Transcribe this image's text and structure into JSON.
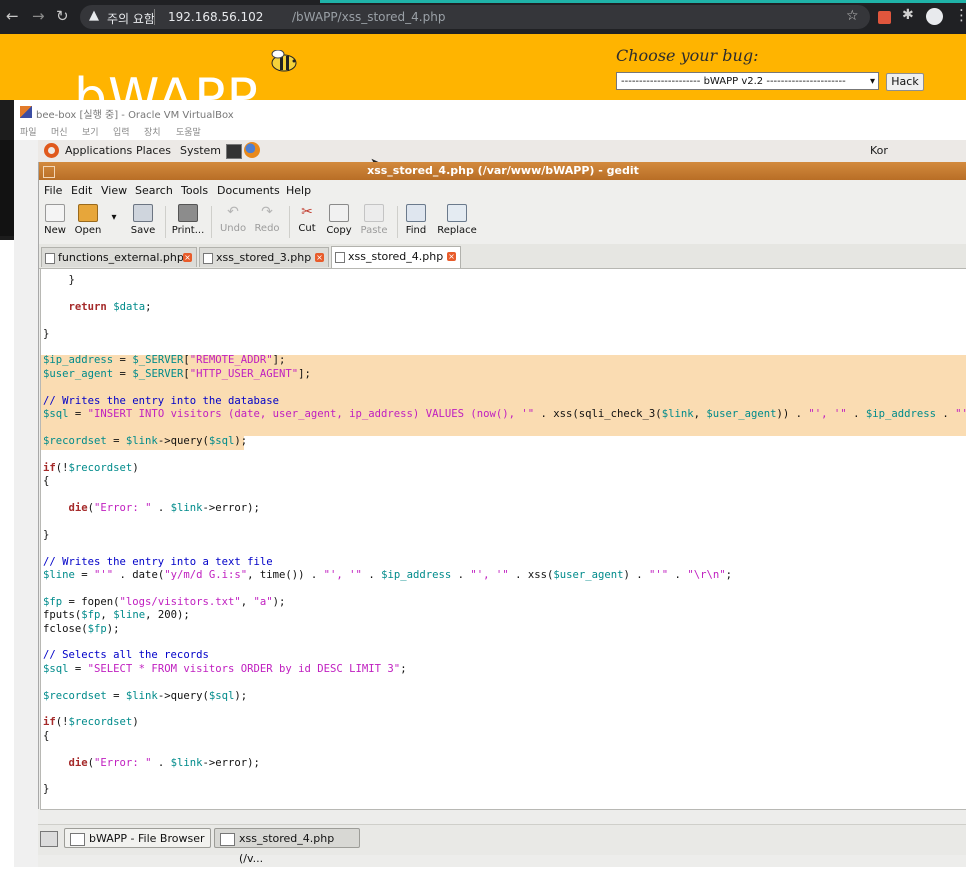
{
  "browser": {
    "security_icon": "warning-triangle-icon",
    "security_text": "주의 요함",
    "url_host": "192.168.56.102",
    "url_path": "/bWAPP/xss_stored_4.php"
  },
  "bwapp": {
    "logo_text": "bWAPP",
    "choose_bug_label": "Choose your bug:",
    "selected_bug": "---------------------- bWAPP v2.2 ----------------------",
    "hack_button": "Hack"
  },
  "vbox": {
    "title": "bee-box [실행 중] - Oracle VM VirtualBox",
    "menu": [
      "파일",
      "머신",
      "보기",
      "입력",
      "장치",
      "도움말"
    ]
  },
  "gnome_panel": {
    "items": [
      "Applications",
      "Places",
      "System"
    ],
    "keyboard_layout": "Kor"
  },
  "gedit": {
    "title": "xss_stored_4.php (/var/www/bWAPP) - gedit",
    "menu": [
      "File",
      "Edit",
      "View",
      "Search",
      "Tools",
      "Documents",
      "Help"
    ],
    "toolbar": {
      "new": "New",
      "open": "Open",
      "save": "Save",
      "print": "Print...",
      "undo": "Undo",
      "redo": "Redo",
      "cut": "Cut",
      "copy": "Copy",
      "paste": "Paste",
      "find": "Find",
      "replace": "Replace"
    },
    "tabs": [
      "functions_external.php",
      "xss_stored_3.php",
      "xss_stored_4.php"
    ],
    "active_tab": "xss_stored_4.php",
    "code": [
      "    }",
      "",
      "    return $data;",
      "",
      "}",
      "",
      "$ip_address = $_SERVER[\"REMOTE_ADDR\"];",
      "$user_agent = $_SERVER[\"HTTP_USER_AGENT\"];",
      "",
      "// Writes the entry into the database",
      "$sql = \"INSERT INTO visitors (date, user_agent, ip_address) VALUES (now(), '\" . xss(sqli_check_3($link, $user_agent)) . \"', '\" . $ip_address . \"')\";",
      "",
      "$recordset = $link->query($sql);",
      "",
      "if(!$recordset)",
      "{",
      "",
      "    die(\"Error: \" . $link->error);",
      "",
      "}",
      "",
      "// Writes the entry into a text file",
      "$line = \"'\" . date(\"y/m/d G.i:s\", time()) . \"', '\" . $ip_address . \"', '\" . xss($user_agent) . \"'\" . \"\\r\\n\";",
      "",
      "$fp = fopen(\"logs/visitors.txt\", \"a\");",
      "fputs($fp, $line, 200);",
      "fclose($fp);",
      "",
      "// Selects all the records",
      "$sql = \"SELECT * FROM visitors ORDER by id DESC LIMIT 3\";",
      "",
      "$recordset = $link->query($sql);",
      "",
      "if(!$recordset)",
      "{",
      "",
      "    die(\"Error: \" . $link->error);",
      "",
      "}"
    ]
  },
  "taskbar": {
    "items": [
      "bWAPP - File Browser",
      "xss_stored_4.php (/v..."
    ]
  }
}
